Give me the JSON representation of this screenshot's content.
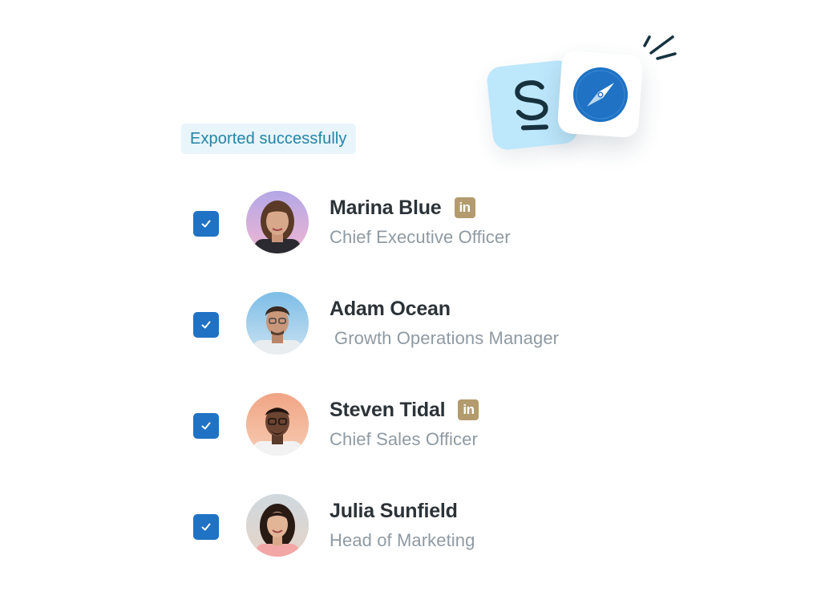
{
  "toast": {
    "message": "Exported successfully"
  },
  "badges": {
    "app_logo_icon": "s-logo-icon",
    "browser_icon": "compass-icon",
    "accent": "#1f72c4"
  },
  "contacts": [
    {
      "name": "Marina Blue",
      "title": "Chief Executive Officer",
      "selected": true,
      "linkedin": "in"
    },
    {
      "name": "Adam Ocean",
      "title": "Growth Operations Manager",
      "selected": true
    },
    {
      "name": "Steven Tidal",
      "title": "Chief Sales Officer",
      "selected": true,
      "linkedin": "in"
    },
    {
      "name": "Julia Sunfield",
      "title": "Head of Marketing",
      "selected": true
    }
  ],
  "colors": {
    "checkbox": "#1f72c4",
    "linkedin_badge": "#b39b6d",
    "toast_bg": "#e8f5fb",
    "toast_text": "#2384a6",
    "name_text": "#2c3338",
    "title_text": "#8f9aa3"
  }
}
